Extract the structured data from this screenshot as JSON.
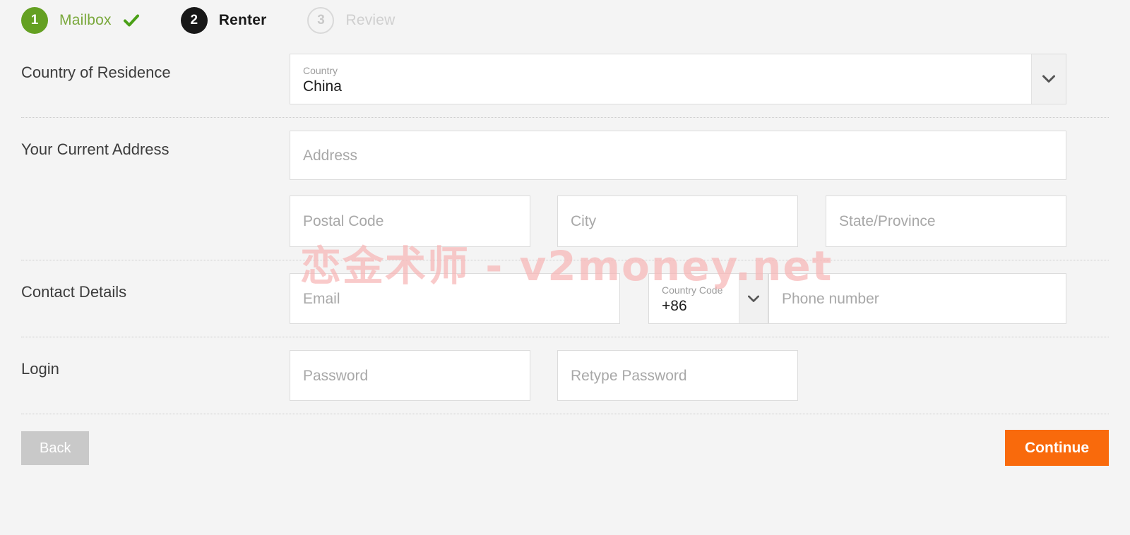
{
  "stepper": {
    "steps": [
      {
        "number": "1",
        "label": "Mailbox",
        "state": "done",
        "check_icon": "check-icon"
      },
      {
        "number": "2",
        "label": "Renter",
        "state": "active"
      },
      {
        "number": "3",
        "label": "Review",
        "state": "todo"
      }
    ]
  },
  "colors": {
    "done_green": "#64a022",
    "done_label_green": "#7aa83c",
    "active_black": "#171717",
    "todo_grey": "#cfcfcf",
    "continue_orange": "#f96a0c",
    "back_grey": "#c9c9c9",
    "page_background": "#f4f4f4",
    "watermark_pink": "#f7b6b6"
  },
  "form": {
    "country_of_residence": {
      "label": "Country of Residence",
      "country_select": {
        "mini_label": "Country",
        "value": "China",
        "arrow_icon": "chevron-down-icon"
      }
    },
    "current_address": {
      "label": "Your Current Address",
      "address_placeholder": "Address",
      "postal_code_placeholder": "Postal Code",
      "city_placeholder": "City",
      "state_province_placeholder": "State/Province"
    },
    "contact_details": {
      "label": "Contact Details",
      "email_placeholder": "Email",
      "country_code": {
        "mini_label": "Country Code",
        "value": "+86",
        "arrow_icon": "chevron-down-icon"
      },
      "phone_placeholder": "Phone number"
    },
    "login": {
      "label": "Login",
      "password_placeholder": "Password",
      "retype_password_placeholder": "Retype Password"
    }
  },
  "footer": {
    "back_label": "Back",
    "continue_label": "Continue"
  },
  "watermark": {
    "text": "恋金术师 - v2money.net"
  }
}
